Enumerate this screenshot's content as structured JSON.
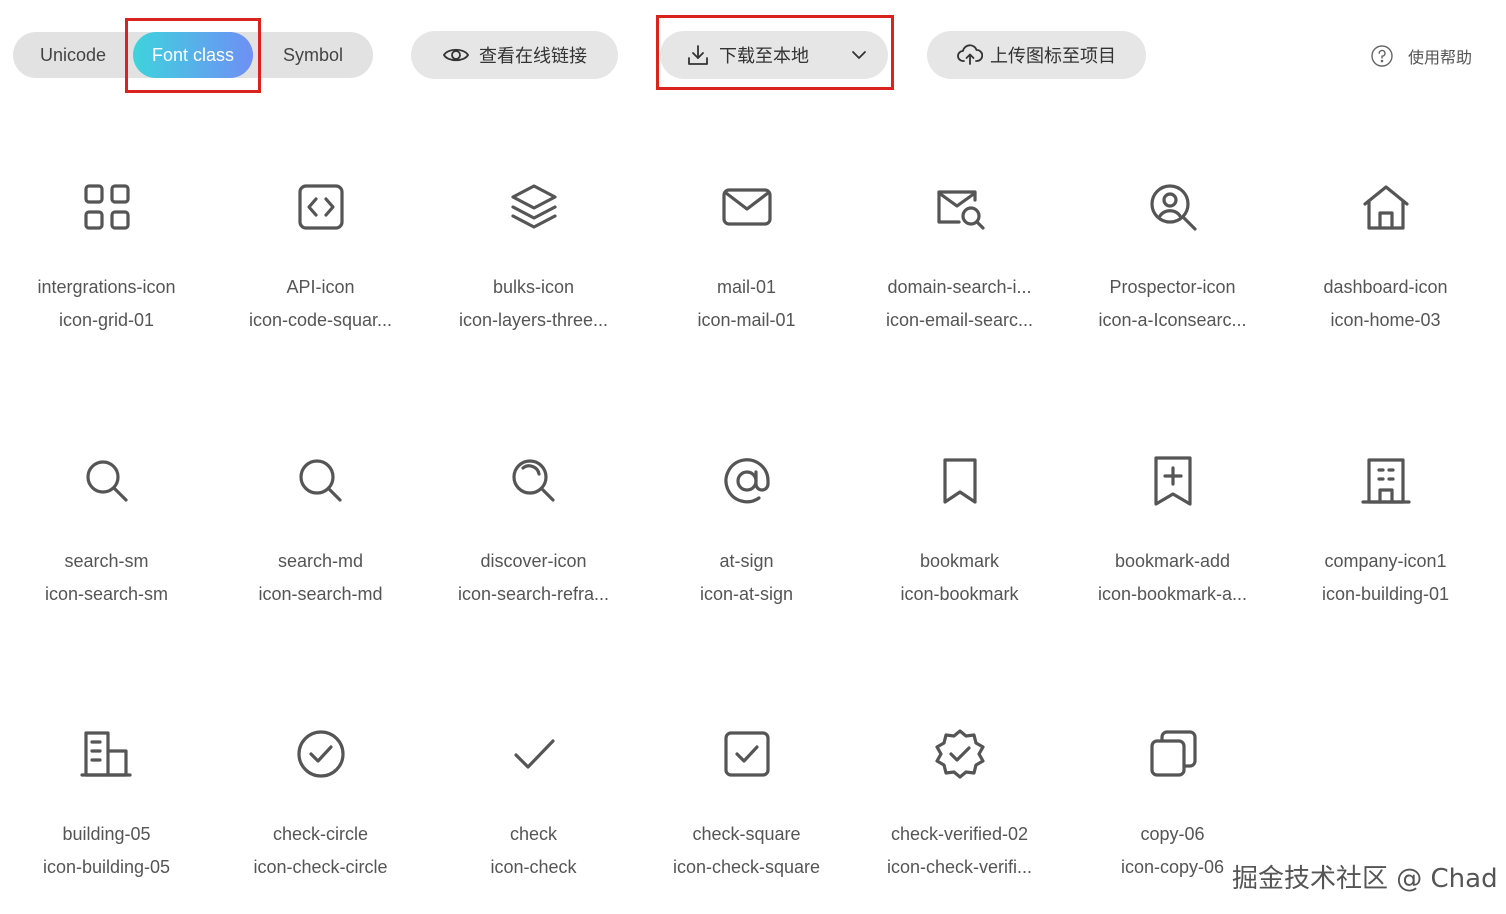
{
  "tabs": {
    "unicode": "Unicode",
    "font_class": "Font class",
    "symbol": "Symbol",
    "active": "font_class"
  },
  "toolbar": {
    "view_online_link": "查看在线链接",
    "download_local": "下载至本地",
    "upload_to_project": "上传图标至项目",
    "help": "使用帮助"
  },
  "colors": {
    "highlight_box": "#d9231f",
    "active_tab_gradient": [
      "#3ed3dd",
      "#6f8ff5"
    ],
    "icon_stroke": "#555555",
    "button_bg": "#e6e6e6"
  },
  "icons": [
    {
      "name": "intergrations-icon",
      "code": "icon-grid-01",
      "glyph": "grid-icon"
    },
    {
      "name": "API-icon",
      "code": "icon-code-squar...",
      "glyph": "code-square-icon"
    },
    {
      "name": "bulks-icon",
      "code": "icon-layers-three...",
      "glyph": "layers-icon"
    },
    {
      "name": "mail-01",
      "code": "icon-mail-01",
      "glyph": "mail-icon"
    },
    {
      "name": "domain-search-i...",
      "code": "icon-email-searc...",
      "glyph": "email-search-icon"
    },
    {
      "name": "Prospector-icon",
      "code": "icon-a-Iconsearc...",
      "glyph": "user-search-icon"
    },
    {
      "name": "dashboard-icon",
      "code": "icon-home-03",
      "glyph": "home-icon"
    },
    {
      "name": "search-sm",
      "code": "icon-search-sm",
      "glyph": "search-sm-icon"
    },
    {
      "name": "search-md",
      "code": "icon-search-md",
      "glyph": "search-md-icon"
    },
    {
      "name": "discover-icon",
      "code": "icon-search-refra...",
      "glyph": "search-refraction-icon"
    },
    {
      "name": "at-sign",
      "code": "icon-at-sign",
      "glyph": "at-sign-icon"
    },
    {
      "name": "bookmark",
      "code": "icon-bookmark",
      "glyph": "bookmark-icon"
    },
    {
      "name": "bookmark-add",
      "code": "icon-bookmark-a...",
      "glyph": "bookmark-add-icon"
    },
    {
      "name": "company-icon1",
      "code": "icon-building-01",
      "glyph": "building-01-icon"
    },
    {
      "name": "building-05",
      "code": "icon-building-05",
      "glyph": "building-05-icon"
    },
    {
      "name": "check-circle",
      "code": "icon-check-circle",
      "glyph": "check-circle-icon"
    },
    {
      "name": "check",
      "code": "icon-check",
      "glyph": "check-icon"
    },
    {
      "name": "check-square",
      "code": "icon-check-square",
      "glyph": "check-square-icon"
    },
    {
      "name": "check-verified-02",
      "code": "icon-check-verifi...",
      "glyph": "check-verified-icon"
    },
    {
      "name": "copy-06",
      "code": "icon-copy-06",
      "glyph": "copy-icon"
    }
  ],
  "watermark": "掘金技术社区 @ Chad"
}
